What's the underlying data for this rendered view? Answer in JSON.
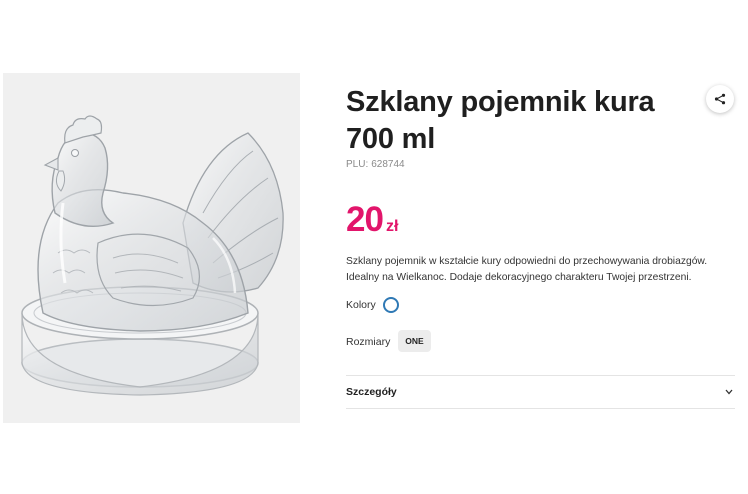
{
  "product": {
    "title": "Szklany pojemnik kura 700 ml",
    "plu_label": "PLU:",
    "plu_value": "628744",
    "price_value": "20",
    "price_currency": "zł",
    "description": "Szklany pojemnik w kształcie kury odpowiedni do przechowywania drobiazgów. Idealny na Wielkanoc. Dodaje dekoracyjnego charakteru Twojej przestrzeni."
  },
  "options": {
    "colors_label": "Kolory",
    "sizes_label": "Rozmiary",
    "size_selected": "ONE"
  },
  "details": {
    "label": "Szczegóły"
  },
  "icons": {
    "share": "share-icon",
    "chevron": "chevron-down-icon"
  },
  "colors": {
    "accent": "#e2156b",
    "swatch_border": "#2f79b5",
    "image_background": "#f0f0f0"
  }
}
